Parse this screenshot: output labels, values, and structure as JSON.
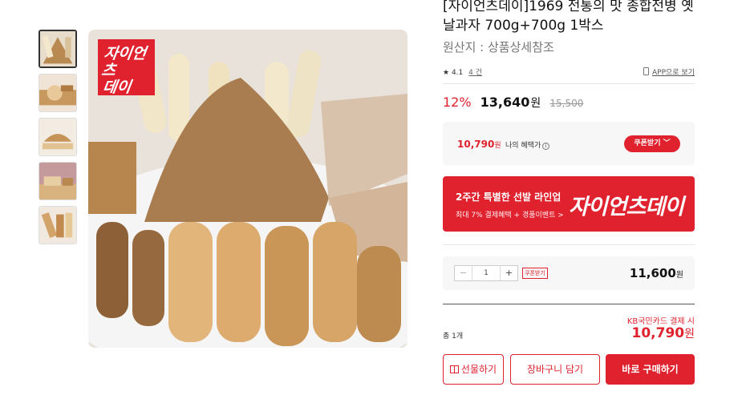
{
  "product": {
    "title": "[자이언츠데이]1969 전통의 맛 종합전병 옛날과자 700g+700g 1박스",
    "origin": "원산지 : 상품상세참조",
    "rating": "4.1",
    "reviews": "4 건",
    "app_link": "APP으로 보기",
    "badge_line1": "자이언츠",
    "badge_line2": "데이"
  },
  "price": {
    "discount": "12%",
    "sale": "13,640",
    "unit": "원",
    "original": "15,500"
  },
  "benefit": {
    "price": "10,790",
    "unit": "원",
    "label": "나의 혜택가",
    "info_glyph": "i",
    "coupon_button": "쿠폰받기 ﹀"
  },
  "promo": {
    "title": "2주간 특별한 선발 라인업",
    "subtitle": "최대 7% 결제혜택 + 경품이벤트 >",
    "brand": "자이언츠데이"
  },
  "quantity": {
    "minus": "−",
    "value": "1",
    "plus": "+",
    "coupon_tag": "쿠폰받기",
    "line_price": "11,600",
    "unit": "원"
  },
  "total": {
    "label": "총 1개",
    "card_text": "KB국민카드 결제 시",
    "price": "10,790",
    "unit": "원"
  },
  "buttons": {
    "gift": "선물하기",
    "cart": "장바구니 담기",
    "buy": "바로 구매하기"
  },
  "colors": {
    "accent": "#e0222f",
    "muted_bg": "#f7f7f7"
  },
  "icons": [
    "star-icon",
    "phone-icon",
    "info-icon",
    "chevron-down-icon",
    "gift-icon"
  ]
}
